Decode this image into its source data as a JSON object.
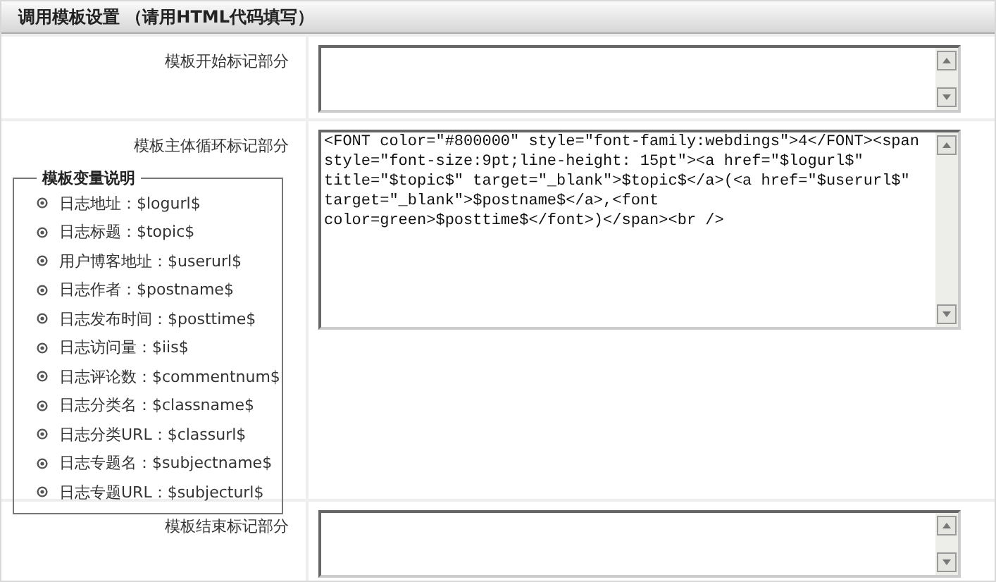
{
  "header": {
    "title": "调用模板设置 （请用HTML代码填写）"
  },
  "rows": [
    {
      "label": "模板开始标记部分",
      "value": ""
    },
    {
      "label": "模板主体循环标记部分",
      "value": "<FONT color=\"#800000\" style=\"font-family:webdings\">4</FONT><span style=\"font-size:9pt;line-height: 15pt\"><a href=\"$logurl$\" title=\"$topic$\" target=\"_blank\">$topic$</a>(<a href=\"$userurl$\" target=\"_blank\">$postname$</a>,<font color=green>$posttime$</font>)</span><br />"
    },
    {
      "label": "模板结束标记部分",
      "value": ""
    }
  ],
  "legend": {
    "title": "模板变量说明",
    "items": [
      "日志地址：$logurl$",
      "日志标题：$topic$",
      "用户博客地址：$userurl$",
      "日志作者：$postname$",
      "日志发布时间：$posttime$",
      "日志访问量：$iis$",
      "日志评论数：$commentnum$",
      "日志分类名：$classname$",
      "日志分类URL：$classurl$",
      "日志专题名：$subjectname$",
      "日志专题URL：$subjecturl$"
    ]
  }
}
